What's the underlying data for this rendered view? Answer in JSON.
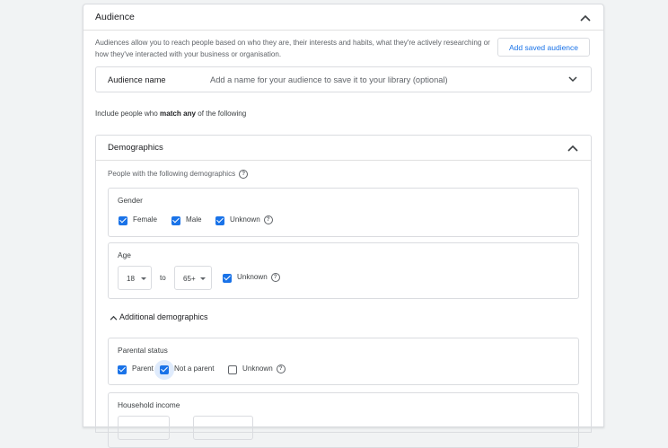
{
  "audience": {
    "title": "Audience",
    "intro": "Audiences allow you to reach people based on who they are, their interests and habits, what they're actively researching or how they've interacted with your business or organisation.",
    "add_saved_label": "Add saved audience",
    "name_field": {
      "label": "Audience name",
      "placeholder": "Add a name for your audience to save it to your library (optional)"
    },
    "include_prefix": "Include people who ",
    "include_bold": "match any",
    "include_suffix": " of the following"
  },
  "demographics": {
    "title": "Demographics",
    "subtext": "People with the following demographics",
    "gender": {
      "label": "Gender",
      "options": [
        {
          "label": "Female",
          "checked": true
        },
        {
          "label": "Male",
          "checked": true
        },
        {
          "label": "Unknown",
          "checked": true
        }
      ]
    },
    "age": {
      "label": "Age",
      "from": "18",
      "to_label": "to",
      "to": "65+",
      "unknown_label": "Unknown",
      "unknown_checked": true
    },
    "additional_label": "Additional demographics",
    "parental": {
      "label": "Parental status",
      "options": [
        {
          "label": "Parent",
          "checked": true
        },
        {
          "label": "Not a parent",
          "checked": true
        },
        {
          "label": "Unknown",
          "checked": false
        }
      ]
    },
    "household": {
      "label": "Household income"
    }
  },
  "colors": {
    "accent": "#1a73e8",
    "border": "#dadce0",
    "text": "#3c4043"
  }
}
